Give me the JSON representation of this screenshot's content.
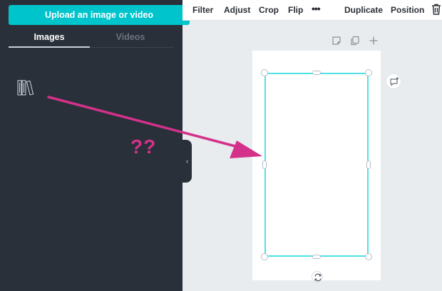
{
  "sidebar": {
    "upload_label": "Upload an image or video",
    "tabs": [
      {
        "label": "Images",
        "active": true
      },
      {
        "label": "Videos",
        "active": false
      }
    ],
    "icon": "media-library-icon"
  },
  "annotation": {
    "text": "??",
    "color": "#d4318a"
  },
  "toolbar": {
    "filter": "Filter",
    "adjust": "Adjust",
    "crop": "Crop",
    "flip": "Flip",
    "more": "•••",
    "duplicate": "Duplicate",
    "position": "Position",
    "delete_icon": "trash-icon"
  },
  "canvas": {
    "page_controls": [
      "note-icon",
      "duplicate-page-icon",
      "add-page-icon"
    ],
    "comment_icon": "comment-icon",
    "rotate_icon": "rotate-icon",
    "selection_color": "#4de2e6"
  },
  "colors": {
    "accent": "#00c4cc",
    "sidebar_bg": "#293039",
    "canvas_bg": "#e9ecef"
  }
}
